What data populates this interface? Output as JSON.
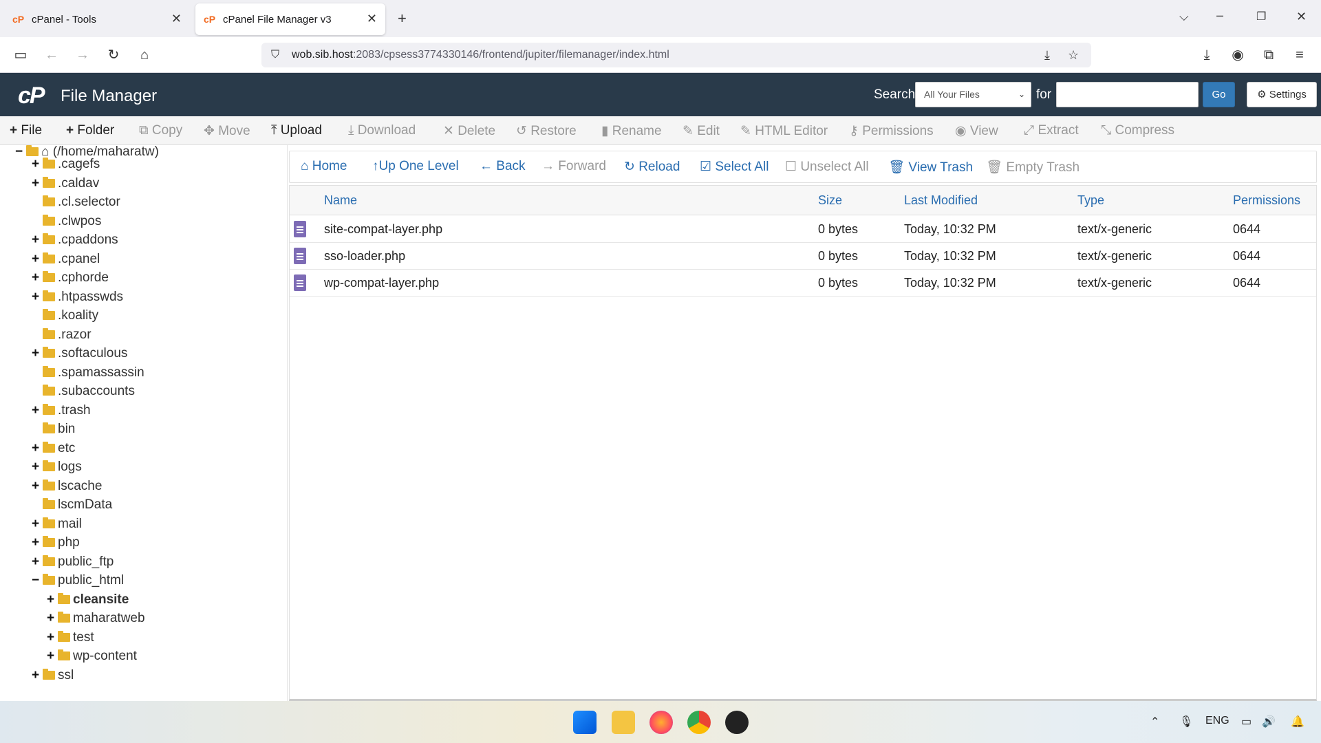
{
  "browser": {
    "tabs": [
      {
        "title": "cPanel - Tools",
        "active": false
      },
      {
        "title": "cPanel File Manager v3",
        "active": true
      }
    ],
    "url_host": "wob.sib.host",
    "url_rest": ":2083/cpsess3774330146/frontend/jupiter/filemanager/index.html"
  },
  "header": {
    "logo": "cP",
    "title": "File Manager",
    "search_label": "Search",
    "search_scope": "All Your Files",
    "for_label": "for",
    "search_value": "",
    "go_label": "Go",
    "settings_label": "Settings"
  },
  "toolbar": {
    "file": "File",
    "folder": "Folder",
    "copy": "Copy",
    "move": "Move",
    "upload": "Upload",
    "download": "Download",
    "delete": "Delete",
    "restore": "Restore",
    "rename": "Rename",
    "edit": "Edit",
    "html_editor": "HTML Editor",
    "permissions": "Permissions",
    "view": "View",
    "extract": "Extract",
    "compress": "Compress"
  },
  "tree": {
    "root": "(/home/maharatw)",
    "items": [
      {
        "name": ".cagefs",
        "expandable": true
      },
      {
        "name": ".caldav",
        "expandable": true
      },
      {
        "name": ".cl.selector",
        "expandable": false
      },
      {
        "name": ".clwpos",
        "expandable": false
      },
      {
        "name": ".cpaddons",
        "expandable": true
      },
      {
        "name": ".cpanel",
        "expandable": true
      },
      {
        "name": ".cphorde",
        "expandable": true
      },
      {
        "name": ".htpasswds",
        "expandable": true
      },
      {
        "name": ".koality",
        "expandable": false
      },
      {
        "name": ".razor",
        "expandable": false
      },
      {
        "name": ".softaculous",
        "expandable": true
      },
      {
        "name": ".spamassassin",
        "expandable": false
      },
      {
        "name": ".subaccounts",
        "expandable": false
      },
      {
        "name": ".trash",
        "expandable": true
      },
      {
        "name": "bin",
        "expandable": false
      },
      {
        "name": "etc",
        "expandable": true
      },
      {
        "name": "logs",
        "expandable": true
      },
      {
        "name": "lscache",
        "expandable": true
      },
      {
        "name": "lscmData",
        "expandable": false
      },
      {
        "name": "mail",
        "expandable": true
      },
      {
        "name": "php",
        "expandable": true
      },
      {
        "name": "public_ftp",
        "expandable": true
      },
      {
        "name": "public_html",
        "expandable": true,
        "expanded": true
      },
      {
        "name": "cleansite",
        "expandable": true,
        "child": true,
        "selected": true
      },
      {
        "name": "maharatweb",
        "expandable": true,
        "child": true
      },
      {
        "name": "test",
        "expandable": true,
        "child": true
      },
      {
        "name": "wp-content",
        "expandable": true,
        "child": true
      },
      {
        "name": "ssl",
        "expandable": true
      }
    ]
  },
  "filenav": {
    "home": "Home",
    "up": "Up One Level",
    "back": "Back",
    "forward": "Forward",
    "reload": "Reload",
    "select_all": "Select All",
    "unselect_all": "Unselect All",
    "view_trash": "View Trash",
    "empty_trash": "Empty Trash"
  },
  "table": {
    "headers": {
      "name": "Name",
      "size": "Size",
      "modified": "Last Modified",
      "type": "Type",
      "perms": "Permissions"
    },
    "rows": [
      {
        "name": "site-compat-layer.php",
        "size": "0 bytes",
        "modified": "Today, 10:32 PM",
        "type": "text/x-generic",
        "perms": "0644"
      },
      {
        "name": "sso-loader.php",
        "size": "0 bytes",
        "modified": "Today, 10:32 PM",
        "type": "text/x-generic",
        "perms": "0644"
      },
      {
        "name": "wp-compat-layer.php",
        "size": "0 bytes",
        "modified": "Today, 10:32 PM",
        "type": "text/x-generic",
        "perms": "0644"
      }
    ]
  },
  "taskbar": {
    "lang": "ENG"
  }
}
